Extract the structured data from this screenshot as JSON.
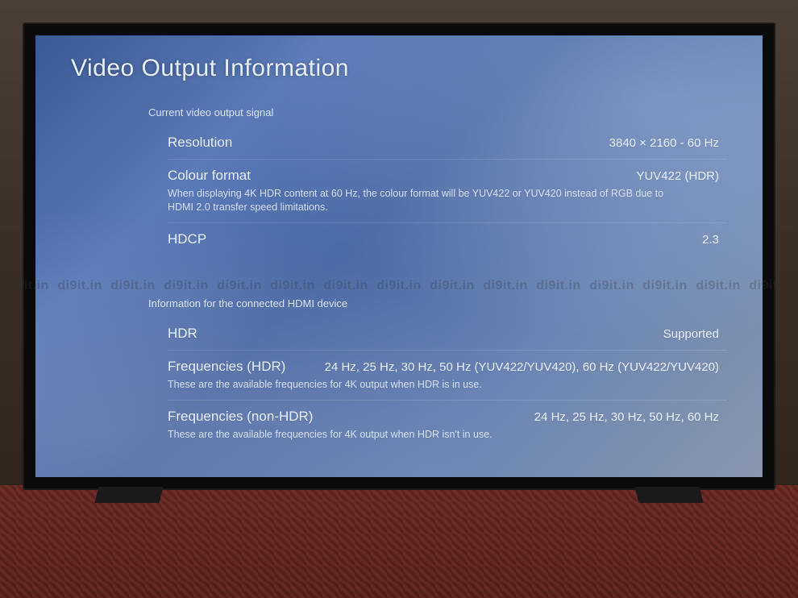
{
  "pageTitle": "Video Output Information",
  "section1Header": "Current video output signal",
  "section2Header": "Information for the connected HDMI device",
  "rows1": {
    "resolution": {
      "label": "Resolution",
      "value": "3840 × 2160 - 60 Hz"
    },
    "colourFormat": {
      "label": "Colour format",
      "value": "YUV422 (HDR)",
      "desc": "When displaying 4K HDR content at 60 Hz, the colour format will be YUV422 or YUV420 instead of RGB due to HDMI 2.0 transfer speed limitations."
    },
    "hdcp": {
      "label": "HDCP",
      "value": "2.3"
    }
  },
  "rows2": {
    "hdr": {
      "label": "HDR",
      "value": "Supported"
    },
    "freqHdr": {
      "label": "Frequencies (HDR)",
      "value": "24 Hz, 25 Hz, 30 Hz, 50 Hz (YUV422/YUV420), 60 Hz (YUV422/YUV420)",
      "desc": "These are the available frequencies for 4K output when HDR is in use."
    },
    "freqNonHdr": {
      "label": "Frequencies (non-HDR)",
      "value": "24 Hz, 25 Hz, 30 Hz, 50 Hz, 60 Hz",
      "desc": "These are the available frequencies for 4K output when HDR isn't in use."
    }
  },
  "watermark": "di9it.in"
}
